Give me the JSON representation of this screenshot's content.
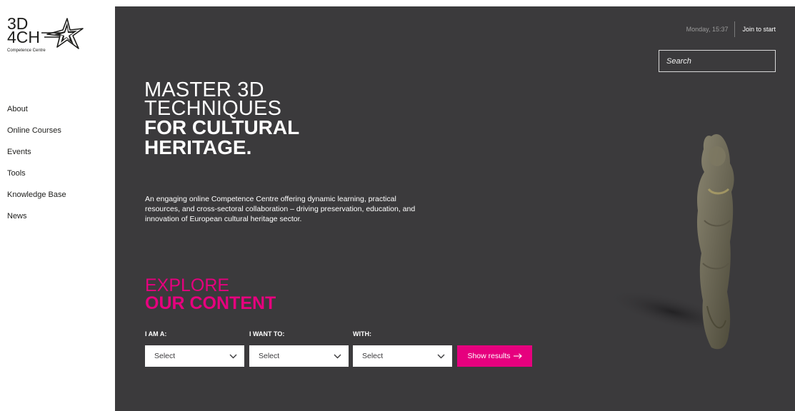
{
  "logo": {
    "line1": "3D",
    "line2": "4CH",
    "subtitle": "Competence Centre",
    "icon": "star-icon"
  },
  "sidebar": {
    "items": [
      {
        "label": "About"
      },
      {
        "label": "Online Courses"
      },
      {
        "label": "Events"
      },
      {
        "label": "Tools"
      },
      {
        "label": "Knowledge Base"
      },
      {
        "label": "News"
      }
    ]
  },
  "topbar": {
    "datetime": "Monday, 15:37",
    "join_label": "Join to start"
  },
  "search": {
    "placeholder": "Search",
    "value": ""
  },
  "hero": {
    "headline_light_1": "MASTER 3D",
    "headline_light_2": "TECHNIQUES",
    "headline_bold_1": "FOR CULTURAL",
    "headline_bold_2": "HERITAGE.",
    "description_line1": "An engaging online Competence Centre offering dynamic learning, practical",
    "description_line2": "resources, and cross-sectoral collaboration – driving preservation, education, and",
    "description_line3": "innovation of European cultural heritage sector."
  },
  "explore": {
    "title_light": "EXPLORE",
    "title_bold": "OUR CONTENT",
    "filters": [
      {
        "label": "I AM A:",
        "selected": "Select"
      },
      {
        "label": "I WANT TO:",
        "selected": "Select"
      },
      {
        "label": "WITH:",
        "selected": "Select"
      }
    ],
    "submit_label": "Show results",
    "submit_icon": "arrow-right-icon"
  },
  "colors": {
    "hero_bg": "#3b3a3c",
    "accent": "#e6007e",
    "text_light": "#ffffff",
    "text_dark": "#1d1d1b"
  }
}
